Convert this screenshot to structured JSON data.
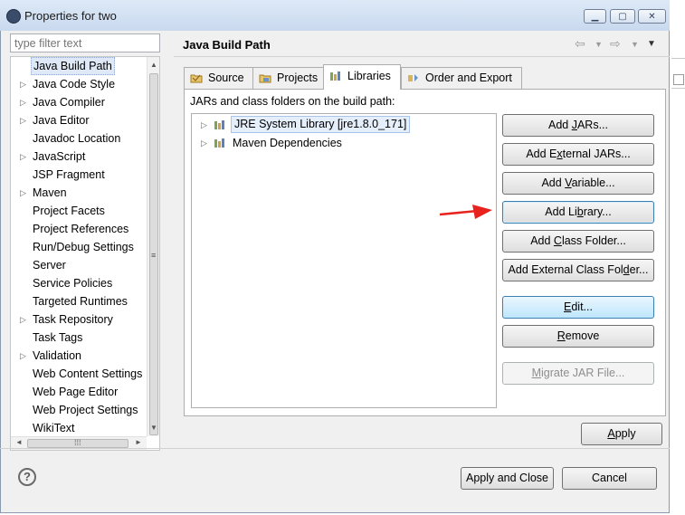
{
  "window": {
    "title": "Properties for two"
  },
  "filter": {
    "placeholder": "type filter text"
  },
  "tree": {
    "items": [
      {
        "label": "Java Build Path",
        "expandable": false,
        "selected": true
      },
      {
        "label": "Java Code Style",
        "expandable": true
      },
      {
        "label": "Java Compiler",
        "expandable": true
      },
      {
        "label": "Java Editor",
        "expandable": true
      },
      {
        "label": "Javadoc Location",
        "expandable": false
      },
      {
        "label": "JavaScript",
        "expandable": true
      },
      {
        "label": "JSP Fragment",
        "expandable": false
      },
      {
        "label": "Maven",
        "expandable": true
      },
      {
        "label": "Project Facets",
        "expandable": false
      },
      {
        "label": "Project References",
        "expandable": false
      },
      {
        "label": "Run/Debug Settings",
        "expandable": false
      },
      {
        "label": "Server",
        "expandable": false
      },
      {
        "label": "Service Policies",
        "expandable": false
      },
      {
        "label": "Targeted Runtimes",
        "expandable": false
      },
      {
        "label": "Task Repository",
        "expandable": true
      },
      {
        "label": "Task Tags",
        "expandable": false
      },
      {
        "label": "Validation",
        "expandable": true
      },
      {
        "label": "Web Content Settings",
        "expandable": false
      },
      {
        "label": "Web Page Editor",
        "expandable": false
      },
      {
        "label": "Web Project Settings",
        "expandable": false
      },
      {
        "label": "WikiText",
        "expandable": false
      }
    ]
  },
  "page": {
    "title": "Java Build Path"
  },
  "tabs": [
    {
      "label": "Source",
      "icon": "source-folder-icon"
    },
    {
      "label": "Projects",
      "icon": "projects-icon"
    },
    {
      "label": "Libraries",
      "icon": "libraries-icon",
      "active": true
    },
    {
      "label": "Order and Export",
      "icon": "order-export-icon"
    }
  ],
  "libraries": {
    "caption": "JARs and class folders on the build path:",
    "entries": [
      {
        "label": "JRE System Library [jre1.8.0_171]",
        "selected": true
      },
      {
        "label": "Maven Dependencies"
      }
    ]
  },
  "buttons": {
    "add_jars": {
      "pre": "Add ",
      "u": "J",
      "post": "ARs..."
    },
    "add_external_jars": {
      "pre": "Add E",
      "u": "x",
      "post": "ternal JARs..."
    },
    "add_variable": {
      "pre": "Add ",
      "u": "V",
      "post": "ariable..."
    },
    "add_library": {
      "pre": "Add Li",
      "u": "b",
      "post": "rary..."
    },
    "add_class_folder": {
      "pre": "Add ",
      "u": "C",
      "post": "lass Folder..."
    },
    "add_external_class_folder": {
      "pre": "Add External Class Fol",
      "u": "d",
      "post": "er..."
    },
    "edit": {
      "pre": "",
      "u": "E",
      "post": "dit..."
    },
    "remove": {
      "pre": "",
      "u": "R",
      "post": "emove"
    },
    "migrate_jar": {
      "pre": "",
      "u": "M",
      "post": "igrate JAR File..."
    }
  },
  "footer": {
    "apply": {
      "pre": "",
      "u": "A",
      "post": "pply"
    },
    "apply_and_close": "Apply and Close",
    "cancel": "Cancel"
  },
  "colors": {
    "annotation_arrow": "#e8231e",
    "focus_border": "#3c7fb1"
  }
}
